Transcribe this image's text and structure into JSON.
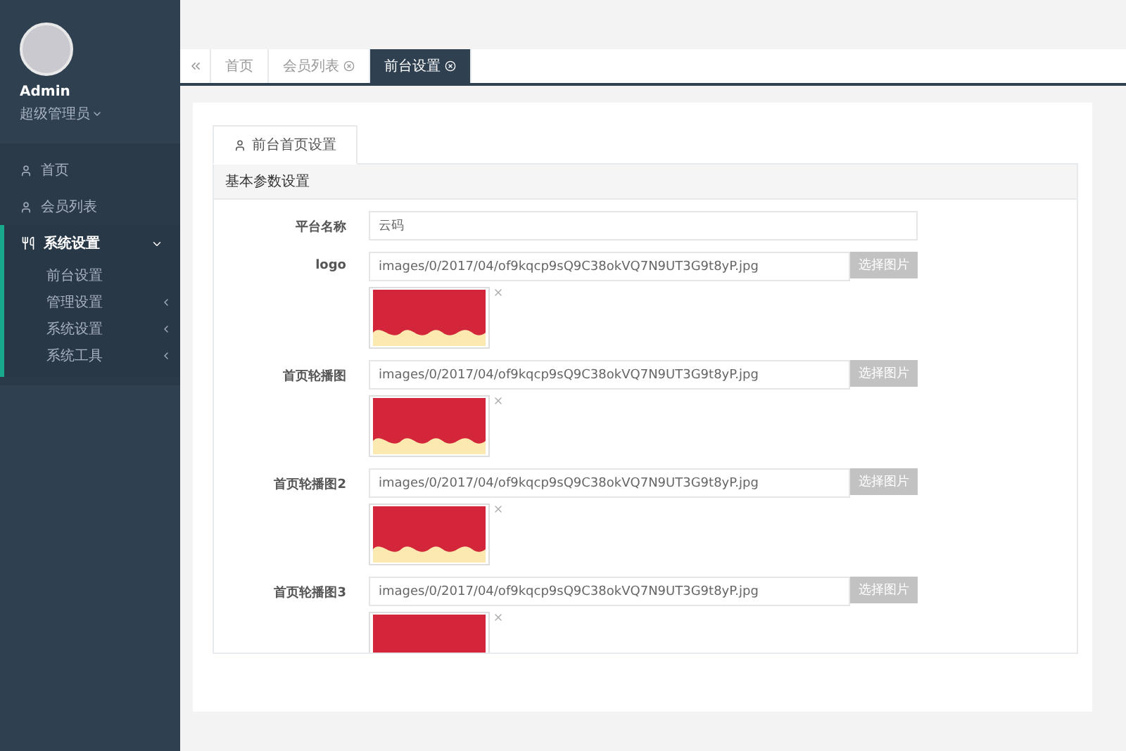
{
  "sidebar": {
    "profile": {
      "name": "Admin",
      "role": "超级管理员"
    },
    "items": [
      {
        "kind": "page",
        "label": "首页",
        "selected": false
      },
      {
        "kind": "page",
        "label": "会员列表",
        "selected": false
      },
      {
        "kind": "group",
        "label": "系统设置",
        "selected": true,
        "expanded": true,
        "children": [
          {
            "kind": "page",
            "label": "前台设置"
          },
          {
            "kind": "group",
            "label": "管理设置"
          },
          {
            "kind": "group",
            "label": "系统设置"
          },
          {
            "kind": "group",
            "label": "系统工具"
          }
        ]
      }
    ]
  },
  "tabs": [
    {
      "label": "首页",
      "closable": false,
      "selected": false
    },
    {
      "label": "会员列表",
      "closable": true,
      "selected": false
    },
    {
      "label": "前台设置",
      "closable": true,
      "selected": true
    }
  ],
  "section_tab": {
    "label": "前台首页设置",
    "selected": true
  },
  "panel": {
    "title": "基本参数设置"
  },
  "fields": [
    {
      "kind": "text",
      "label": "平台名称",
      "value": "云码"
    },
    {
      "kind": "image",
      "label": "logo",
      "value": "images/0/2017/04/of9kqcp9sQ9C38okVQ7N9UT3G9t8yP.jpg",
      "button": "选择图片"
    },
    {
      "kind": "image",
      "label": "首页轮播图",
      "value": "images/0/2017/04/of9kqcp9sQ9C38okVQ7N9UT3G9t8yP.jpg",
      "button": "选择图片"
    },
    {
      "kind": "image",
      "label": "首页轮播图2",
      "value": "images/0/2017/04/of9kqcp9sQ9C38okVQ7N9UT3G9t8yP.jpg",
      "button": "选择图片"
    },
    {
      "kind": "image",
      "label": "首页轮播图3",
      "value": "images/0/2017/04/of9kqcp9sQ9C38okVQ7N9UT3G9t8yP.jpg",
      "button": "选择图片"
    }
  ]
}
